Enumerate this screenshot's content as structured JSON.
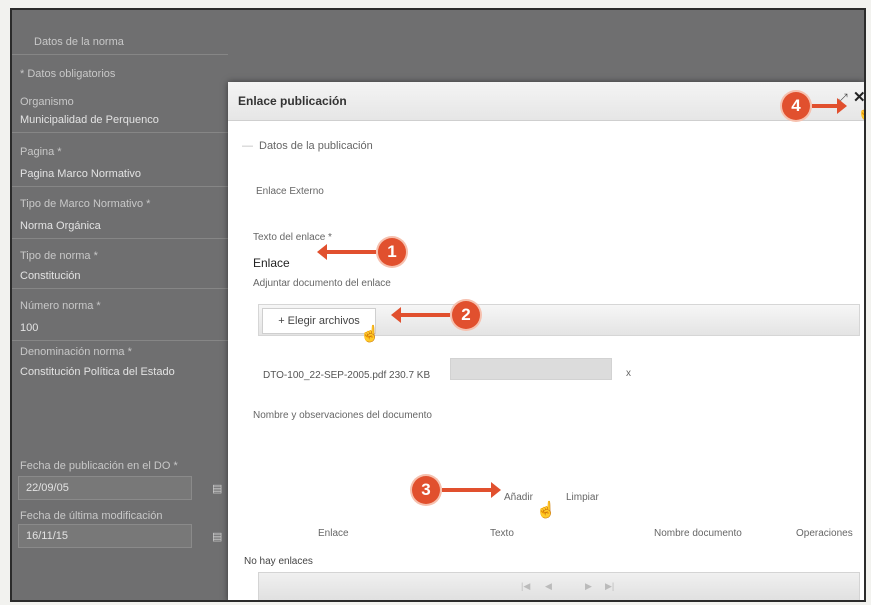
{
  "background_form": {
    "section_title": "Datos de la norma",
    "required_note": "* Datos obligatorios",
    "fields": [
      {
        "label": "Organismo",
        "value": "Municipalidad de Perquenco"
      },
      {
        "label": "Pagina *",
        "value": "Pagina Marco Normativo"
      },
      {
        "label": "Tipo de Marco Normativo *",
        "value": "Norma Orgánica"
      },
      {
        "label": "Tipo de norma *",
        "value": "Constitución"
      },
      {
        "label": "Número norma *",
        "value": "100"
      },
      {
        "label": "Denominación norma *",
        "value": "Constitución Política del Estado"
      }
    ],
    "publication_date": {
      "label": "Fecha de publicación en el DO *",
      "value": "22/09/05"
    },
    "modified_date": {
      "label": "Fecha de última modificación",
      "value": "16/11/15"
    }
  },
  "modal": {
    "title": "Enlace publicación",
    "section": "Datos de la publicación",
    "external_link_label": "Enlace Externo",
    "link_text_label": "Texto del enlace *",
    "link_text_value": "Enlace",
    "attach_label": "Adjuntar documento del enlace",
    "choose_button": "+ Elegir archivos",
    "file_name": "DTO-100_22-SEP-2005.pdf 230.7 KB",
    "file_remove": "x",
    "doc_name_label": "Nombre y observaciones del documento",
    "add_button": "Añadir",
    "clear_button": "Limpiar",
    "table_headers": [
      "Enlace",
      "Texto",
      "Nombre documento",
      "Operaciones"
    ],
    "empty_message": "No hay enlaces"
  },
  "annotations": [
    "1",
    "2",
    "3",
    "4"
  ],
  "colors": {
    "callout": "#e1502e",
    "overlay": "#6f6f70",
    "modal_bg": "#ffffff"
  }
}
